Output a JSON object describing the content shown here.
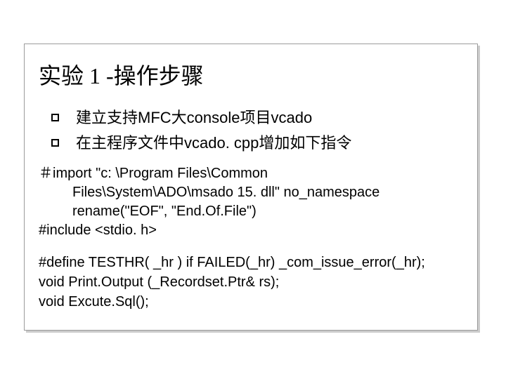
{
  "slide": {
    "title": "实验 1 -操作步骤",
    "bullets": [
      "建立支持MFC大console项目vcado",
      "在主程序文件中vcado. cpp增加如下指令"
    ],
    "code1_line1": "＃import \"c: \\Program Files\\Common",
    "code1_line2": "Files\\System\\ADO\\msado 15. dll\"  no_namespace",
    "code1_line3": "rename(\"EOF\", \"End.Of.File\")",
    "code1_line4": "#include <stdio. h>",
    "code2_line1": "#define TESTHR( _hr )  if FAILED(_hr) _com_issue_error(_hr);",
    "code2_line2": "void Print.Output (_Recordset.Ptr&   rs);",
    "code2_line3": "void Excute.Sql();"
  }
}
